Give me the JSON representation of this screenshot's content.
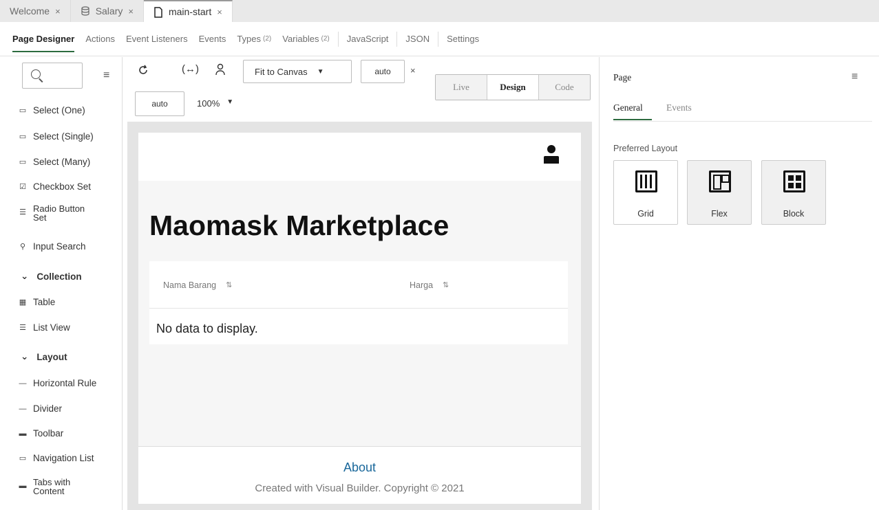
{
  "file_tabs": [
    {
      "label": "Welcome",
      "close": "×"
    },
    {
      "label": "Salary",
      "close": "×"
    },
    {
      "label": "main-start",
      "close": "×"
    }
  ],
  "designer_tabs": {
    "page_designer": "Page Designer",
    "actions": "Actions",
    "event_listeners": "Event Listeners",
    "events": "Events",
    "types": "Types",
    "types_count": "(2)",
    "variables": "Variables",
    "variables_count": "(2)",
    "javascript": "JavaScript",
    "json": "JSON",
    "settings": "Settings"
  },
  "palette": {
    "search_placeholder": "",
    "items": {
      "select_one": "Select (One)",
      "select_single": "Select (Single)",
      "select_many": "Select (Many)",
      "checkbox_set": "Checkbox Set",
      "radio_button_set_1": "Radio Button",
      "radio_button_set_2": "Set",
      "input_search": "Input Search",
      "collection": "Collection",
      "table": "Table",
      "list_view": "List View",
      "layout": "Layout",
      "horizontal_rule": "Horizontal Rule",
      "divider": "Divider",
      "toolbar": "Toolbar",
      "navigation_list": "Navigation List",
      "tabs_with_content_1": "Tabs with",
      "tabs_with_content_2": "Content"
    }
  },
  "canvas_toolbar": {
    "fit": "Fit to Canvas",
    "width": "auto",
    "height": "auto",
    "zoom": "100%",
    "modes": {
      "live": "Live",
      "design": "Design",
      "code": "Code"
    },
    "active_mode": "Design"
  },
  "page_preview": {
    "title": "Maomask Marketplace",
    "columns": [
      "Nama Barang",
      "Harga"
    ],
    "empty_message": "No data to display.",
    "footer_link": "About",
    "copyright": "Created with Visual Builder. Copyright © 2021"
  },
  "properties": {
    "title": "Page",
    "tabs": {
      "general": "General",
      "events": "Events"
    },
    "preferred_layout_label": "Preferred Layout",
    "layouts": {
      "grid": "Grid",
      "flex": "Flex",
      "block": "Block"
    }
  },
  "colors": {
    "accent": "#2c6b3f",
    "link": "#19679a"
  }
}
